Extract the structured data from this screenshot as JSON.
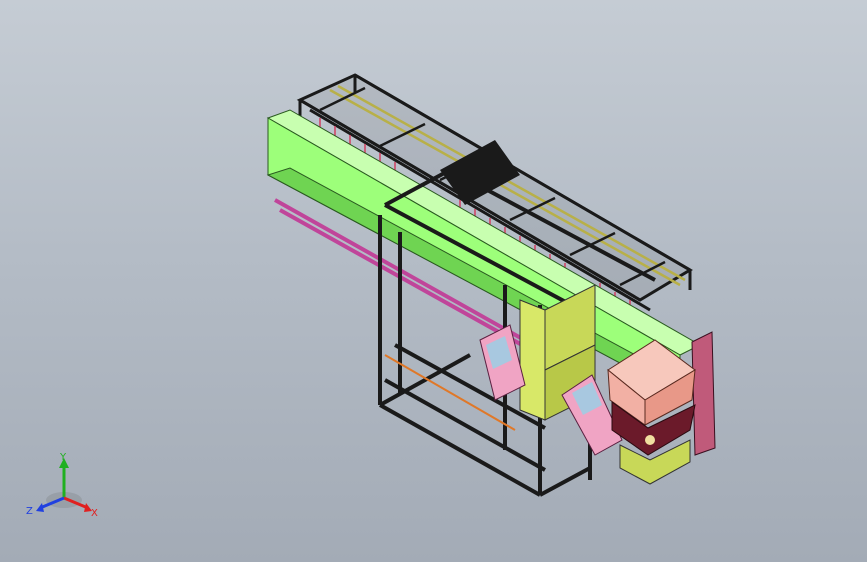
{
  "colors": {
    "frame": "#1a1a1a",
    "beam_green": "#9dff7a",
    "beam_green_dark": "#6fd452",
    "rail_magenta": "#c0459a",
    "pink": "#f0a4c4",
    "salmon": "#f2b0a4",
    "olive": "#c8d858",
    "maroon": "#6b1a2a",
    "orange": "#e07828",
    "axis_x": "#e02020",
    "axis_y": "#20b020",
    "axis_z": "#2040e0"
  },
  "triad": {
    "x_label": "X",
    "y_label": "Y",
    "z_label": "Z"
  }
}
